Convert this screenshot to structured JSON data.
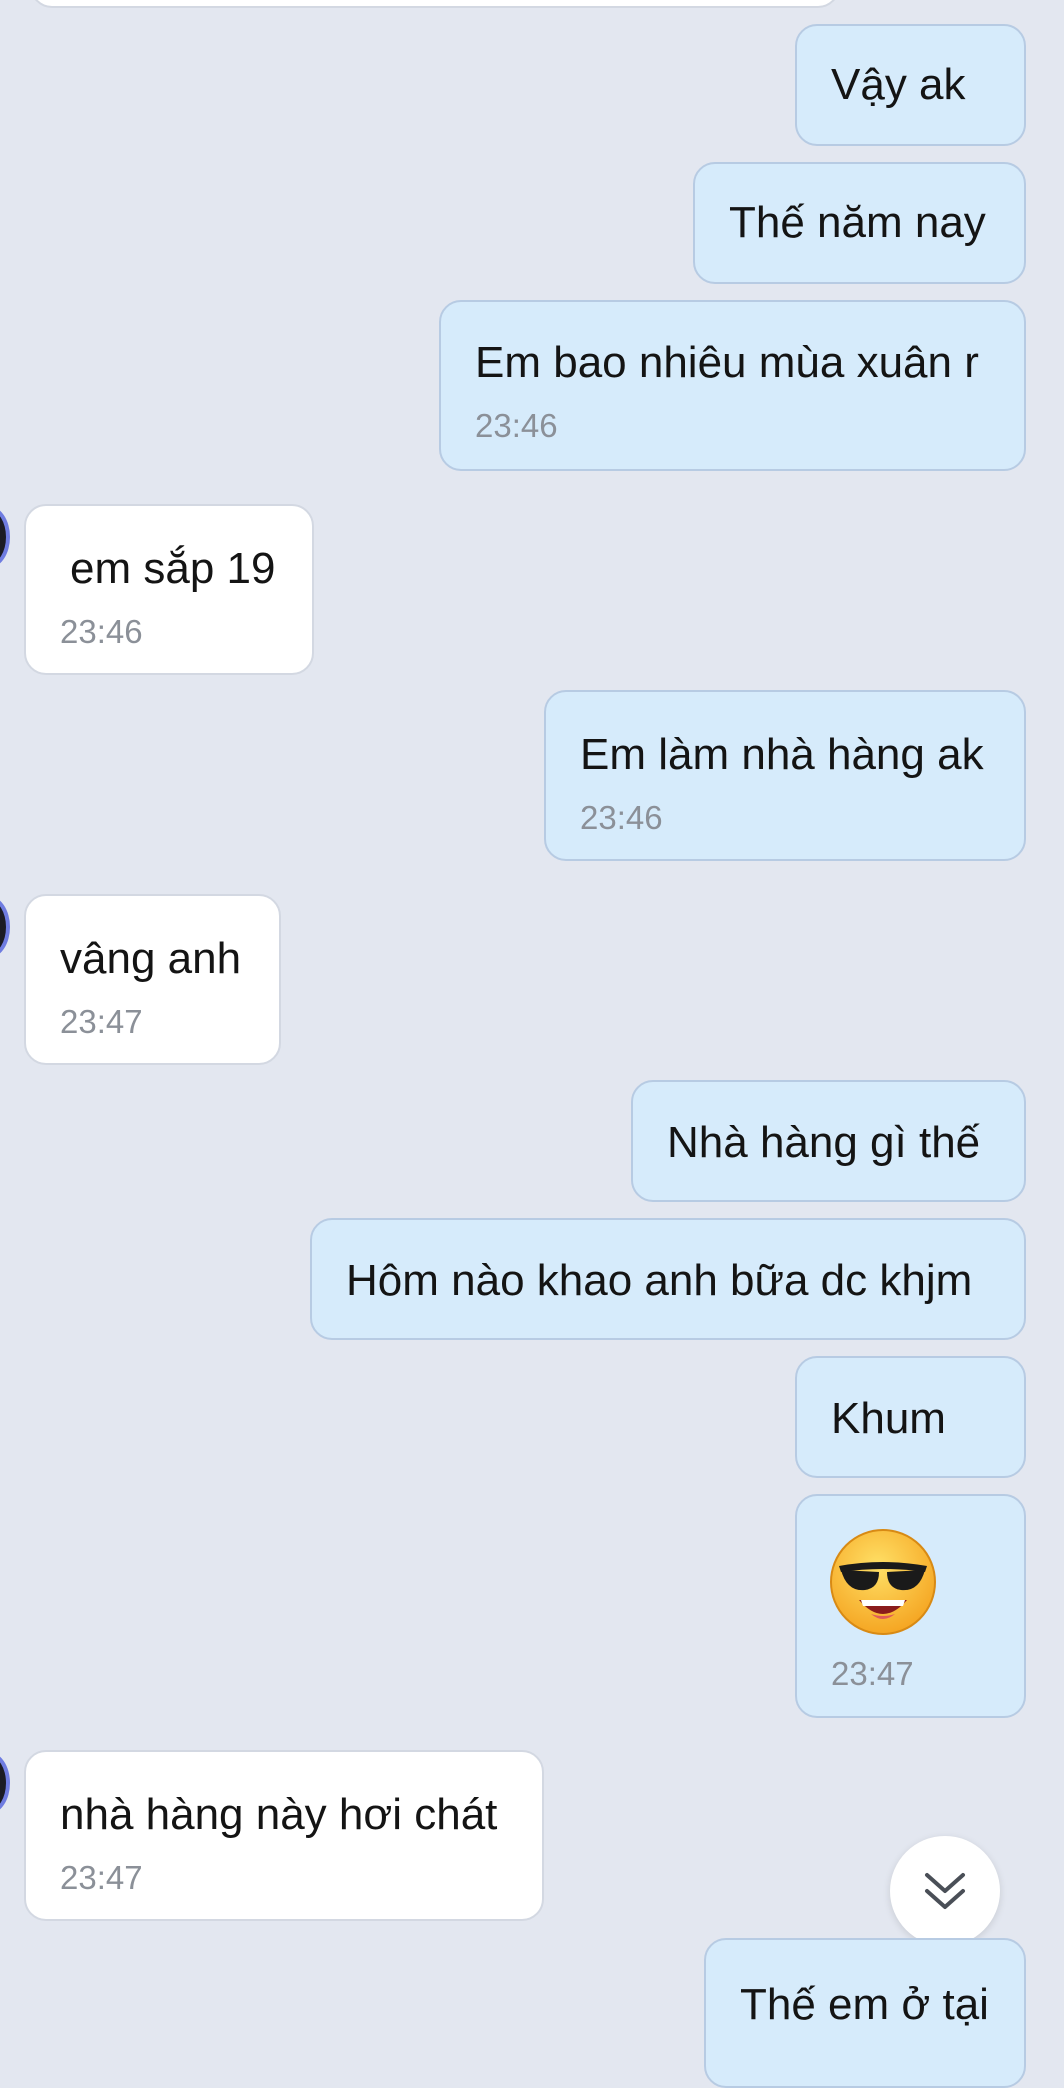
{
  "messages": [
    {
      "id": "m1",
      "side": "sent",
      "text": "Vậy ak",
      "time": ""
    },
    {
      "id": "m2",
      "side": "sent",
      "text": "Thế năm nay",
      "time": ""
    },
    {
      "id": "m3",
      "side": "sent",
      "text": "Em bao nhiêu mùa xuân r",
      "time": "23:46"
    },
    {
      "id": "m4",
      "side": "recv",
      "text": "em sắp 19",
      "time": "23:46"
    },
    {
      "id": "m5",
      "side": "sent",
      "text": "Em làm nhà hàng ak",
      "time": "23:46"
    },
    {
      "id": "m6",
      "side": "recv",
      "text": "vâng anh",
      "time": "23:47"
    },
    {
      "id": "m7",
      "side": "sent",
      "text": "Nhà hàng gì thế",
      "time": ""
    },
    {
      "id": "m8",
      "side": "sent",
      "text": "Hôm nào khao anh bữa dc khjm",
      "time": ""
    },
    {
      "id": "m9",
      "side": "sent",
      "text": "Khum",
      "time": ""
    },
    {
      "id": "m10",
      "side": "sent",
      "emoji": "cool-sunglasses-emoji",
      "time": "23:47"
    },
    {
      "id": "m11",
      "side": "recv",
      "text": "nhà hàng này hơi chát",
      "time": "23:47"
    },
    {
      "id": "m12",
      "side": "sent",
      "text": "Thế em ở tại",
      "time": ""
    }
  ],
  "icons": {
    "scroll_down": "double-chevron-down-icon",
    "avatar": "contact-avatar-icon"
  },
  "colors": {
    "background": "#e3e7f0",
    "sent_bubble": "#d6ebfb",
    "received_bubble": "#ffffff",
    "timestamp": "#8b9098"
  }
}
